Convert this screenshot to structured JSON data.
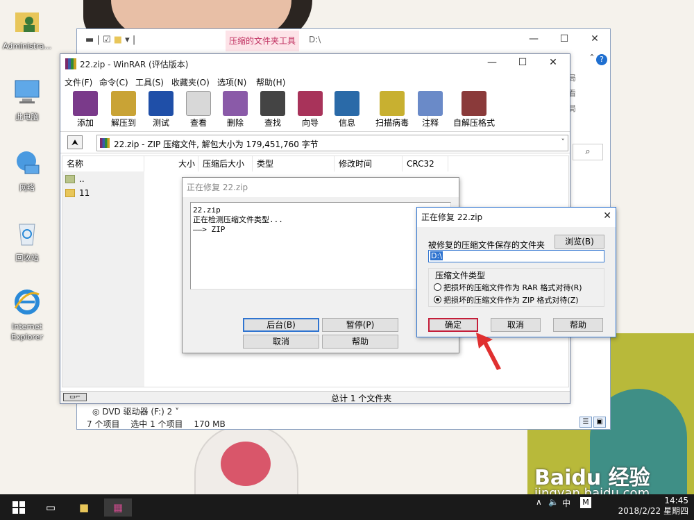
{
  "desktop": {
    "icons": [
      {
        "label": "Administra..."
      },
      {
        "label": "此电脑"
      },
      {
        "label": "网络"
      },
      {
        "label": "回收站"
      },
      {
        "label": "Internet Explorer"
      }
    ]
  },
  "explorer": {
    "context_tab": "压缩的文件夹工具",
    "path": "D:\\",
    "side_chars": [
      "局",
      "看",
      "局"
    ],
    "search_icon": "search-icon",
    "dvd_item": "DVD 驱动器 (F:) 2",
    "status": {
      "items": "7 个项目",
      "selected": "选中 1 个项目",
      "size": "170 MB"
    }
  },
  "winrar": {
    "title": "22.zip - WinRAR (评估版本)",
    "menu": [
      "文件(F)",
      "命令(C)",
      "工具(S)",
      "收藏夹(O)",
      "选项(N)",
      "帮助(H)"
    ],
    "toolbar": [
      {
        "label": "添加",
        "icon": "add-icon",
        "color": "#7a3a8a"
      },
      {
        "label": "解压到",
        "icon": "extract-icon",
        "color": "#c9a335"
      },
      {
        "label": "测试",
        "icon": "test-icon",
        "color": "#1f4fa8"
      },
      {
        "label": "查看",
        "icon": "view-icon",
        "color": "#b8b8b8"
      },
      {
        "label": "删除",
        "icon": "delete-icon",
        "color": "#8a5aa8"
      },
      {
        "label": "查找",
        "icon": "find-icon",
        "color": "#444444"
      },
      {
        "label": "向导",
        "icon": "wizard-icon",
        "color": "#a8335a"
      },
      {
        "label": "信息",
        "icon": "info-icon",
        "color": "#2a6aa8"
      },
      {
        "label": "扫描病毒",
        "icon": "virus-scan-icon",
        "color": "#c8b030"
      },
      {
        "label": "注释",
        "icon": "comment-icon",
        "color": "#6a8ac8"
      },
      {
        "label": "自解压格式",
        "icon": "sfx-icon",
        "color": "#8a3a3a"
      }
    ],
    "address": "22.zip - ZIP 压缩文件, 解包大小为 179,451,760 字节",
    "columns": [
      "名称",
      "大小",
      "压缩后大小",
      "类型",
      "修改时间",
      "CRC32"
    ],
    "rows": [
      {
        "name": ".."
      },
      {
        "name": "11"
      }
    ],
    "status": "总计 1 个文件夹"
  },
  "progress_dialog": {
    "title": "正在修复 22.zip",
    "log": [
      "22.zip",
      "正在检测压缩文件类型...",
      "——> ZIP"
    ],
    "buttons": {
      "background": "后台(B)",
      "pause": "暂停(P)",
      "cancel": "取消",
      "help": "帮助"
    }
  },
  "repair_dialog": {
    "title": "正在修复 22.zip",
    "folder_label": "被修复的压缩文件保存的文件夹",
    "browse": "浏览(B)",
    "folder_value": "D:\\",
    "group_title": "压缩文件类型",
    "options": [
      {
        "label": "把损坏的压缩文件作为 RAR 格式对待(R)",
        "selected": false
      },
      {
        "label": "把损坏的压缩文件作为 ZIP 格式对待(Z)",
        "selected": true
      }
    ],
    "buttons": {
      "ok": "确定",
      "cancel": "取消",
      "help": "帮助"
    }
  },
  "taskbar": {
    "ime": "中",
    "ime2": "M",
    "time": "14:45",
    "date": "2018/2/22 星期四"
  },
  "watermark": {
    "brand": "Baidu 经验",
    "url": "jingyan.baidu.com"
  },
  "colors": {
    "accent": "#2f74d0",
    "highlight_red": "#c41e3a",
    "context_tab": "#fde3e8"
  }
}
